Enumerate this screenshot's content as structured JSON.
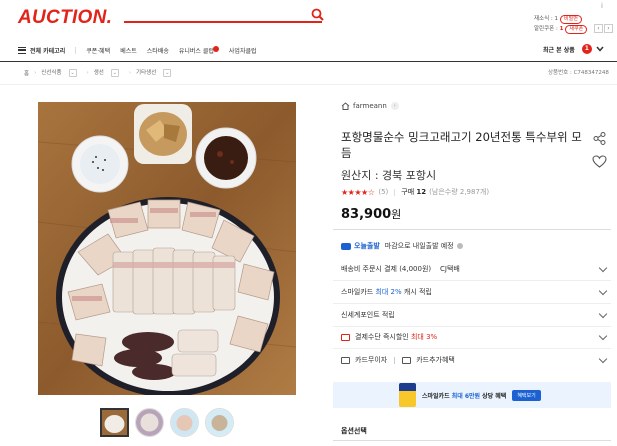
{
  "header": {
    "logo": "AUCTION.",
    "corner": "i",
    "status_line1_label": "재소식 : 1",
    "status_line1_pill": "비밀번",
    "status_line2_label": "알린쿠폰 :",
    "status_line2_num": "1",
    "status_line2_pill": "새쿠폰",
    "pager_prev": "‹",
    "pager_next": "›"
  },
  "nav": {
    "category": "전체 카테고리",
    "items": [
      "쿠폰·혜택",
      "베스트",
      "스타배송",
      "유니버스 클럽",
      "사업자클럽"
    ],
    "recent_label": "최근 본 상품",
    "recent_count": "1"
  },
  "breadcrumb": {
    "home": "홈",
    "levels": [
      "신선식품",
      "생선",
      "기타생선"
    ],
    "product_no": "상품번호 : C748347248"
  },
  "product": {
    "seller": "farmeann",
    "title": "포항명물순수 밍크고래고기 20년전통 특수부위 모듬",
    "origin": "원산지 : 경북 포항시",
    "stars": "★★★★☆",
    "review_count": "(5)",
    "purchase_label": "구매",
    "purchase_count": "12",
    "remaining": "(남은수량 2,987개)",
    "price": "83,900",
    "price_unit": "원"
  },
  "shipping": {
    "today_label": "오늘출발",
    "today_desc": "마감으로 내일출발 예정"
  },
  "rows": {
    "delivery": "배송비 주문시 결제 (4,000원)    CJ택배",
    "smile_pre": "스마일카드 ",
    "smile_hl": "최대 2%",
    "smile_post": " 캐시 적립",
    "shinsegae": "신세계포인트 적립",
    "discount_pre": "결제수단 즉시할인 ",
    "discount_hl": "최대 3%",
    "interest_free": "카드무이자",
    "card_benefit": "카드추가혜택"
  },
  "banner": {
    "text_pre": "스마일카드 ",
    "text_hl": "최대 6만원",
    "text_post": " 상당 혜택",
    "button": "혜택보기"
  },
  "options_label": "옵션선택",
  "colors": {
    "brand": "#e2231a",
    "accent_blue": "#1b61d1"
  }
}
